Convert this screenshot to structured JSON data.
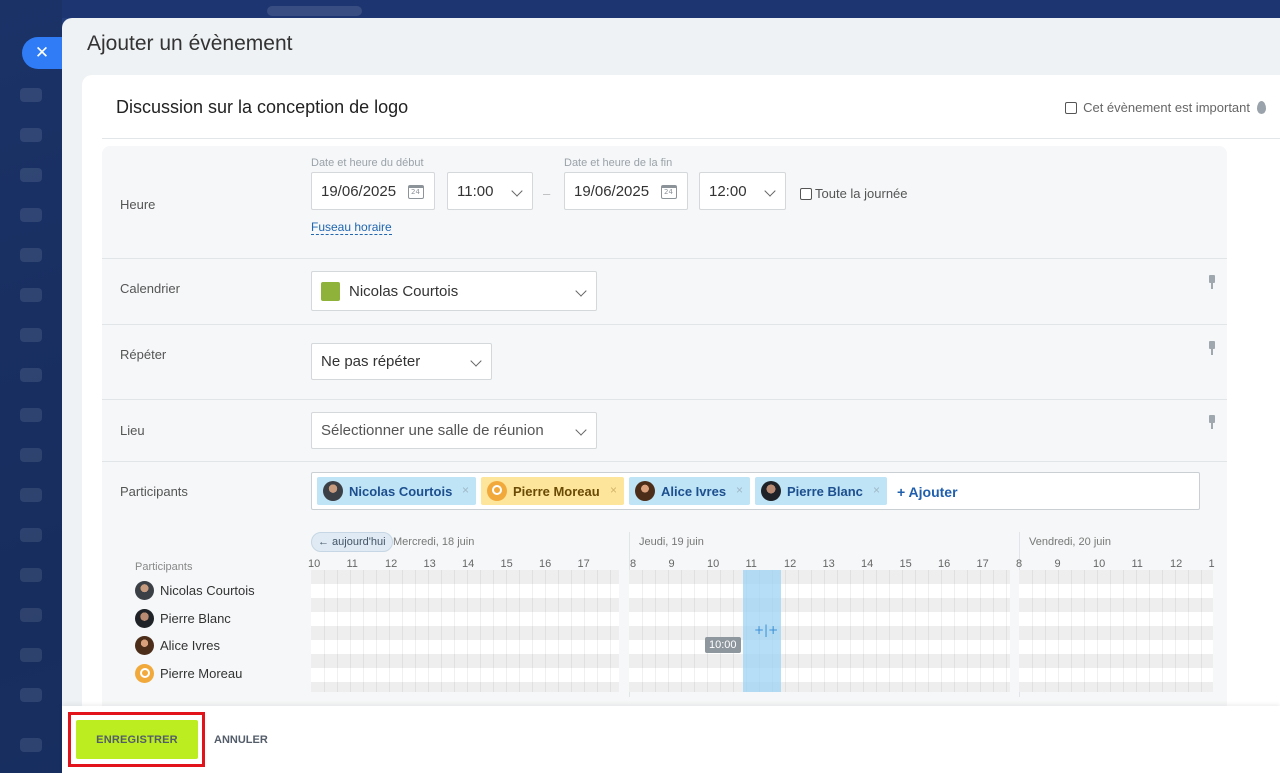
{
  "panel": {
    "title": "Ajouter un évènement"
  },
  "event": {
    "name": "Discussion sur la conception de logo",
    "important_label": "Cet évènement est important"
  },
  "time": {
    "label": "Heure",
    "start_caption": "Date et heure du début",
    "end_caption": "Date et heure de la fin",
    "start_date": "19/06/2025",
    "start_time": "11:00",
    "end_date": "19/06/2025",
    "end_time": "12:00",
    "separator": "–",
    "all_day": "Toute la journée",
    "timezone_link": "Fuseau horaire"
  },
  "calendar": {
    "label": "Calendrier",
    "value": "Nicolas Courtois",
    "color": "#8fb33a"
  },
  "repeat": {
    "label": "Répéter",
    "value": "Ne pas répéter"
  },
  "location": {
    "label": "Lieu",
    "placeholder": "Sélectionner une salle de réunion"
  },
  "participants": {
    "label": "Participants",
    "tags": [
      {
        "name": "Nicolas Courtois",
        "style": "blue"
      },
      {
        "name": "Pierre Moreau",
        "style": "yellow"
      },
      {
        "name": "Alice Ivres",
        "style": "blue"
      },
      {
        "name": "Pierre Blanc",
        "style": "blue"
      }
    ],
    "add_label": "+ Ajouter",
    "remove_glyph": "×"
  },
  "planner": {
    "today_button": "← aujourd'hui",
    "list_header": "Participants",
    "days": [
      {
        "label": "Mercredi, 18 juin",
        "hours": [
          "10",
          "11",
          "12",
          "13",
          "14",
          "15",
          "16",
          "17"
        ]
      },
      {
        "label": "Jeudi, 19 juin",
        "hours": [
          "8",
          "9",
          "10",
          "11",
          "12",
          "13",
          "14",
          "15",
          "16",
          "17"
        ]
      },
      {
        "label": "Vendredi, 20 juin",
        "hours": [
          "8",
          "9",
          "10",
          "11",
          "12",
          "1"
        ]
      }
    ],
    "people": [
      "Nicolas Courtois",
      "Pierre Blanc",
      "Alice Ivres",
      "Pierre Moreau"
    ],
    "now_marker": "10:00",
    "slot_handle": "+|+"
  },
  "footer": {
    "save": "ENREGISTRER",
    "cancel": "ANNULER"
  },
  "colors": {
    "accent": "#2f7cf6",
    "save_button": "#bbed21",
    "highlight": "#e2131b",
    "slot": "#9ed4f4"
  }
}
